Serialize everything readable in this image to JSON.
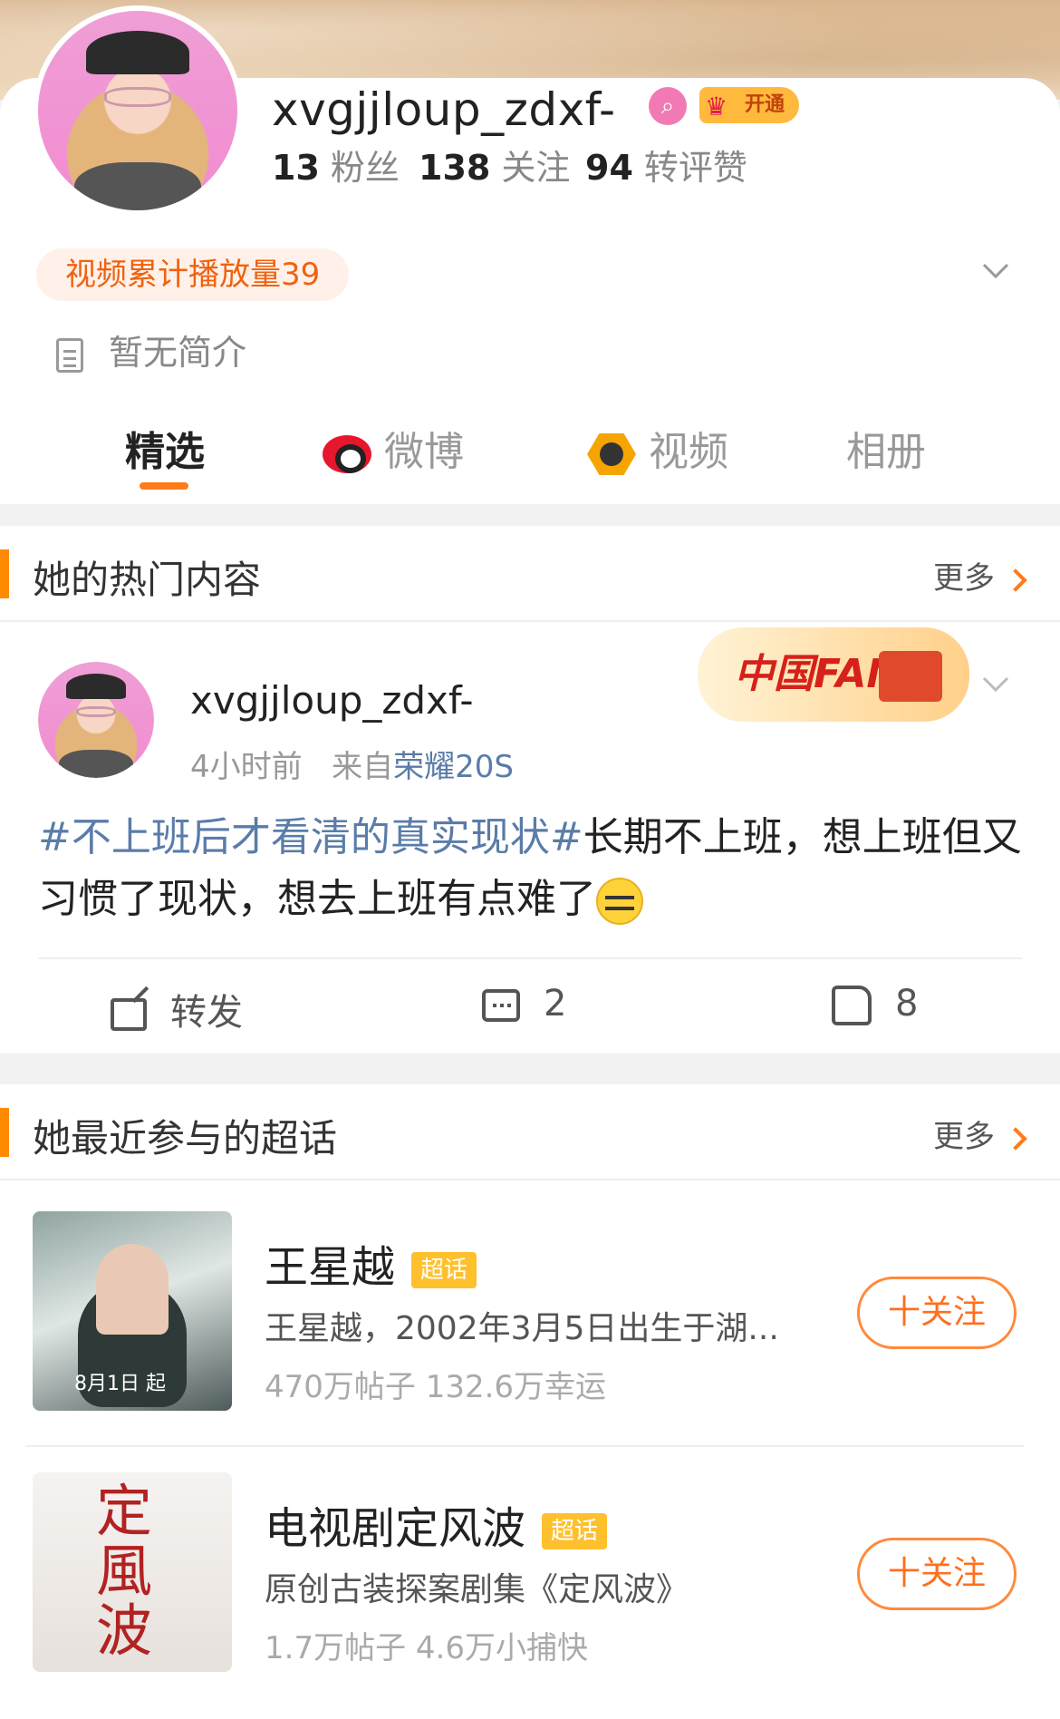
{
  "profile": {
    "username": "xvgjjloup_zdxf-",
    "vip_badge": "开通",
    "stats": [
      {
        "num": "13",
        "label": "粉丝"
      },
      {
        "num": "138",
        "label": "关注"
      },
      {
        "num": "94",
        "label": "转评赞"
      }
    ],
    "video_plays": "视频累计播放量39",
    "bio": "暂无简介"
  },
  "tabs": [
    {
      "label": "精选"
    },
    {
      "label": "微博"
    },
    {
      "label": "视频"
    },
    {
      "label": "相册"
    }
  ],
  "hot": {
    "title": "她的热门内容",
    "more": "更多",
    "post": {
      "author": "xvgjjloup_zdxf-",
      "time": "4小时前",
      "from_prefix": "来自",
      "device": "荣耀20S",
      "topic": "#不上班后才看清的真实现状#",
      "text": "长期不上班，想上班但又习惯了现状，想去上班有点难了",
      "fans_badge": "中国FANS",
      "repost": "转发",
      "comments": "2",
      "likes": "8"
    }
  },
  "super": {
    "title": "她最近参与的超话",
    "more": "更多",
    "tag": "超话",
    "follow": "十关注",
    "items": [
      {
        "name": "王星越",
        "desc": "王星越，2002年3月5日出生于湖...",
        "stat": "470万帖子 132.6万幸运",
        "thumb_caption": "8月1日 起"
      },
      {
        "name": "电视剧定风波",
        "desc": "原创古装探案剧集《定风波》",
        "stat": "1.7万帖子 4.6万小捕快",
        "thumb_caption": ""
      }
    ]
  },
  "colors": {
    "accent": "#ff7a1a",
    "topic_link": "#5a7ca8",
    "super_tag": "#ffc02e"
  }
}
